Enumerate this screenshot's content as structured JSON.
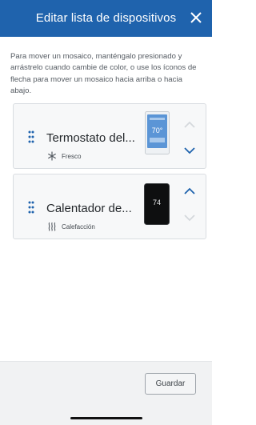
{
  "header": {
    "title": "Editar lista de dispositivos",
    "close_icon": "close-icon",
    "background": "#1f63ad"
  },
  "instructions": "Para mover un mosaico, manténgalo presionado y arrástrelo cuando cambie de color, o use los íconos de flecha para mover un mosaico hacia arriba o hacia abajo.",
  "devices": [
    {
      "name": "Termostato del...",
      "mode_label": "Fresco",
      "mode_icon": "snowflake-icon",
      "display_value": "70°",
      "up_arrow_enabled": false,
      "down_arrow_enabled": true
    },
    {
      "name": "Calentador de...",
      "mode_label": "Calefacción",
      "mode_icon": "heat-waves-icon",
      "display_value": "74",
      "up_arrow_enabled": true,
      "down_arrow_enabled": false
    }
  ],
  "footer": {
    "save_label": "Guardar"
  },
  "colors": {
    "accent": "#1f63ad",
    "arrow_enabled": "#1f63ad",
    "arrow_disabled": "#d4d8dc"
  }
}
